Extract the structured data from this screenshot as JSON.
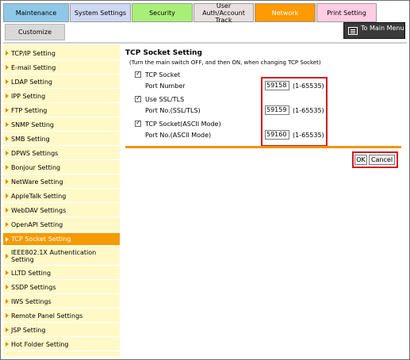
{
  "tabs": [
    {
      "label": "Maintenance",
      "color": "#8ec8e8",
      "active": false
    },
    {
      "label": "System Settings",
      "color": "#cfd8f2",
      "active": false
    },
    {
      "label": "Security",
      "color": "#a8ef78",
      "active": false
    },
    {
      "label": "User Auth/Account Track",
      "color": "#e8e0e0",
      "active": false
    },
    {
      "label": "Network",
      "color": "#ff9a00",
      "active": true
    },
    {
      "label": "Print Setting",
      "color": "#ffcde2",
      "active": false
    }
  ],
  "subbar": {
    "customize_label": "Customize",
    "main_menu_label": "To Main Menu"
  },
  "sidebar": {
    "items": [
      {
        "label": "TCP/IP Setting",
        "active": false
      },
      {
        "label": "E-mail Setting",
        "active": false
      },
      {
        "label": "LDAP Setting",
        "active": false
      },
      {
        "label": "IPP Setting",
        "active": false
      },
      {
        "label": "FTP Setting",
        "active": false
      },
      {
        "label": "SNMP Setting",
        "active": false
      },
      {
        "label": "SMB Setting",
        "active": false
      },
      {
        "label": "DPWS Settings",
        "active": false
      },
      {
        "label": "Bonjour Setting",
        "active": false
      },
      {
        "label": "NetWare Setting",
        "active": false
      },
      {
        "label": "AppleTalk Setting",
        "active": false
      },
      {
        "label": "WebDAV Settings",
        "active": false
      },
      {
        "label": "OpenAPI Setting",
        "active": false
      },
      {
        "label": "TCP Socket Setting",
        "active": true
      },
      {
        "label": "IEEE802.1X Authentication Setting",
        "active": false
      },
      {
        "label": "LLTD Setting",
        "active": false
      },
      {
        "label": "SSDP Settings",
        "active": false
      },
      {
        "label": "IWS Settings",
        "active": false
      },
      {
        "label": "Remote Panel Settings",
        "active": false
      },
      {
        "label": "JSP Setting",
        "active": false
      },
      {
        "label": "Hot Folder Setting",
        "active": false
      }
    ]
  },
  "content": {
    "title": "TCP Socket Setting",
    "note": "(Turn the main switch OFF, and then ON, when changing TCP Socket)",
    "settings": [
      {
        "checkbox_label": "TCP Socket",
        "checked": true,
        "port_label": "Port Number",
        "port_value": "59158",
        "range": "(1-65535)"
      },
      {
        "checkbox_label": "Use SSL/TLS",
        "checked": true,
        "port_label": "Port No.(SSL/TLS)",
        "port_value": "59159",
        "range": "(1-65535)"
      },
      {
        "checkbox_label": "TCP Socket(ASCII Mode)",
        "checked": true,
        "port_label": "Port No.(ASCII Mode)",
        "port_value": "59160",
        "range": "(1-65535)"
      }
    ],
    "ok_label": "OK",
    "cancel_label": "Cancel"
  },
  "colors": {
    "accent": "#f59a00",
    "sidebar_bg": "#fff9c8",
    "highlight": "#d8141c"
  }
}
